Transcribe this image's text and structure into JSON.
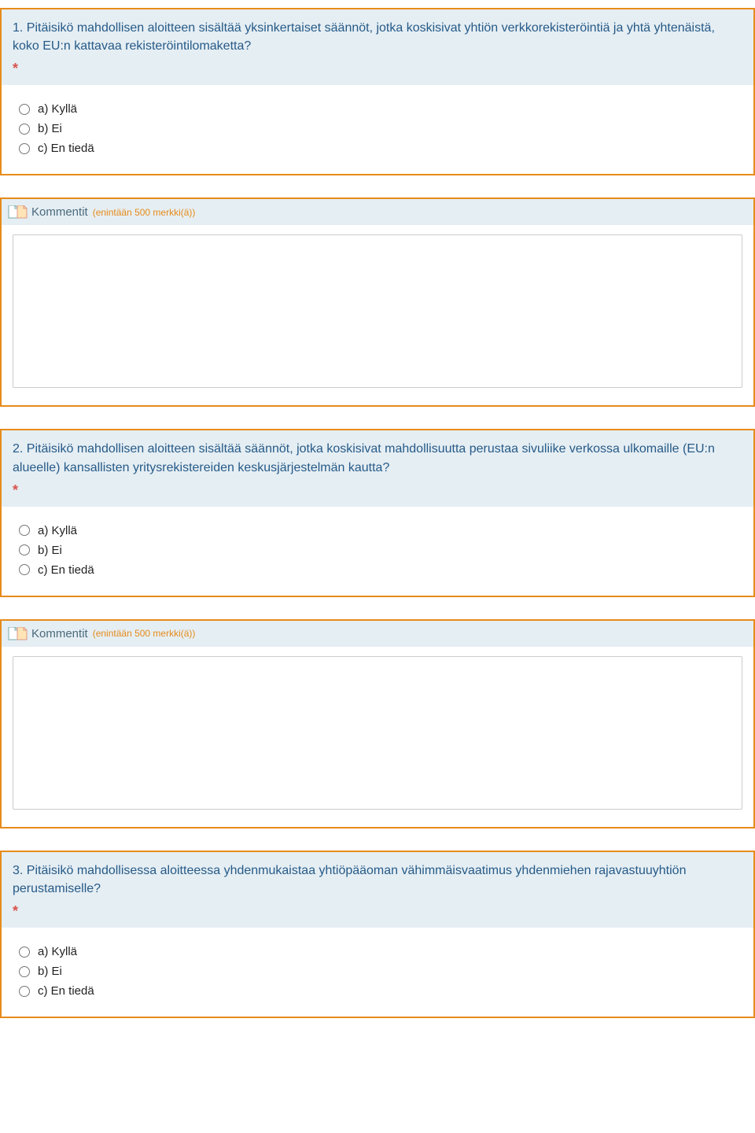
{
  "required_marker": "*",
  "comment": {
    "title": "Kommentit",
    "hint": "(enintään 500 merkki(ä))"
  },
  "options": {
    "a": "a) Kyllä",
    "b": "b) Ei",
    "c": "c) En tiedä"
  },
  "questions": {
    "q1": "1. Pitäisikö mahdollisen aloitteen sisältää yksinkertaiset säännöt, jotka koskisivat yhtiön verkkorekisteröintiä ja yhtä yhtenäistä, koko EU:n kattavaa rekisteröintilomaketta?",
    "q2": "2. Pitäisikö mahdollisen aloitteen sisältää säännöt, jotka koskisivat mahdollisuutta perustaa sivuliike verkossa ulkomaille (EU:n alueelle) kansallisten yritysrekistereiden keskusjärjestelmän kautta?",
    "q3": "3. Pitäisikö mahdollisessa aloitteessa yhdenmukaistaa yhtiöpääoman vähimmäisvaatimus yhdenmiehen rajavastuuyhtiön perustamiselle?"
  }
}
